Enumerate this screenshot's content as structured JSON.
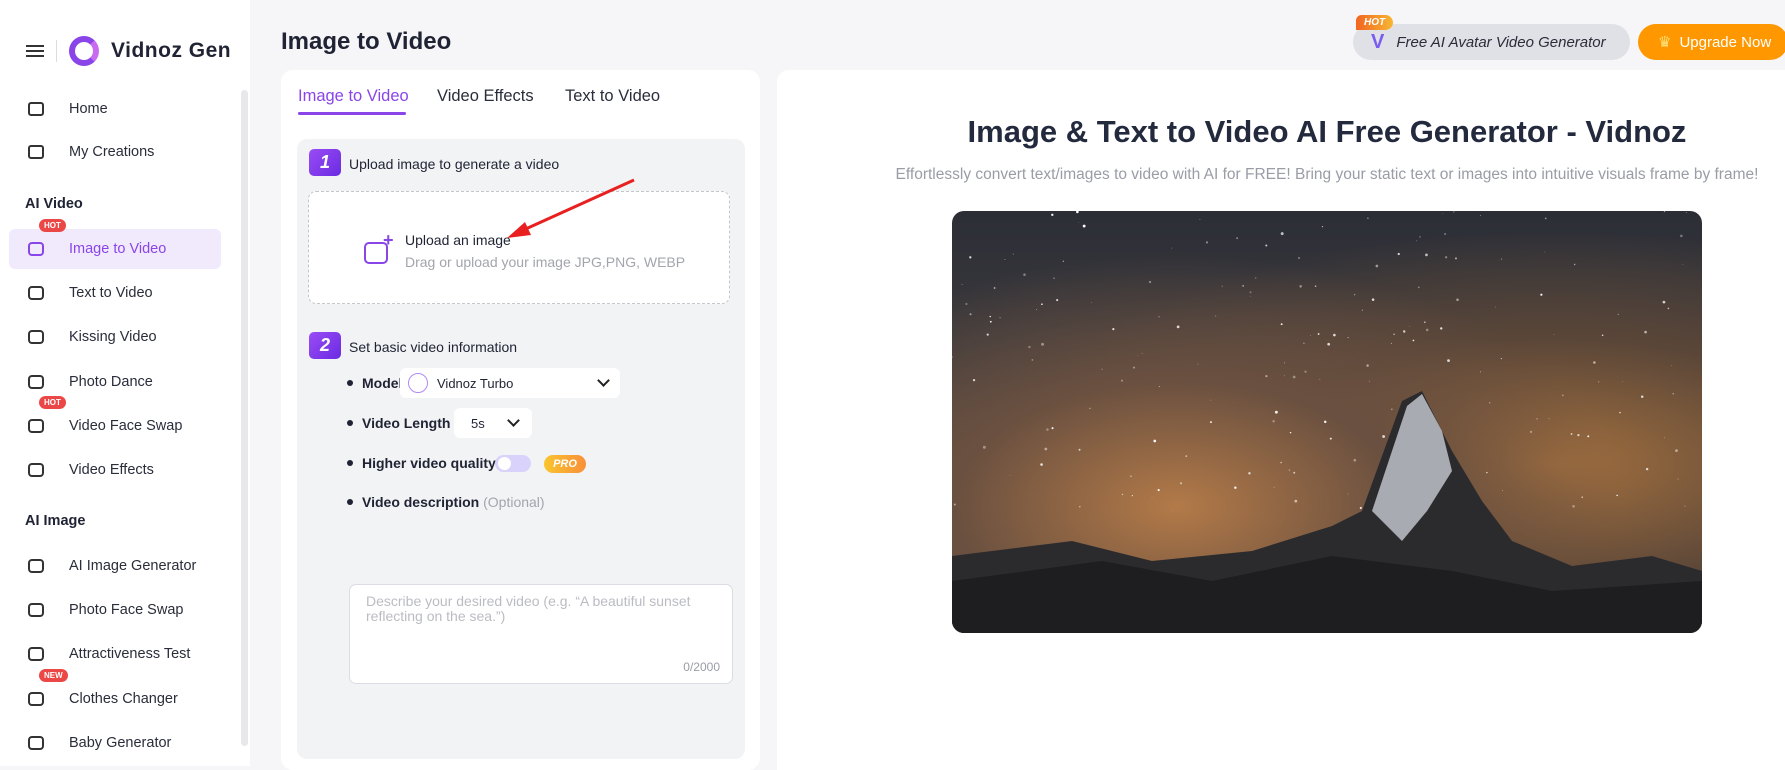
{
  "brand": {
    "name": "Vidnoz Gen",
    "accent": "#8a45e8"
  },
  "sidebar": {
    "top": [
      {
        "label": "Home",
        "icon": "home-icon"
      },
      {
        "label": "My Creations",
        "icon": "archive-icon"
      }
    ],
    "sections": [
      {
        "title": "AI Video",
        "items": [
          {
            "label": "Image to Video",
            "icon": "image-video-icon",
            "badge": "HOT",
            "active": true
          },
          {
            "label": "Text to Video",
            "icon": "text-video-icon"
          },
          {
            "label": "Kissing Video",
            "icon": "hearts-icon"
          },
          {
            "label": "Photo Dance",
            "icon": "dance-icon"
          },
          {
            "label": "Video Face Swap",
            "icon": "face-swap-icon",
            "badge": "HOT"
          },
          {
            "label": "Video Effects",
            "icon": "sparkle-play-icon"
          }
        ]
      },
      {
        "title": "AI Image",
        "items": [
          {
            "label": "AI Image Generator",
            "icon": "sparkles-icon"
          },
          {
            "label": "Photo Face Swap",
            "icon": "face-icon"
          },
          {
            "label": "Attractiveness Test",
            "icon": "face-scan-icon"
          },
          {
            "label": "Clothes Changer",
            "icon": "shirt-icon",
            "badge": "NEW"
          },
          {
            "label": "Baby Generator",
            "icon": "baby-icon"
          }
        ]
      }
    ]
  },
  "header": {
    "title": "Image to Video",
    "promo_tag": "HOT",
    "promo_label": "Free AI Avatar Video Generator",
    "upgrade_label": "Upgrade Now"
  },
  "tabs": [
    {
      "label": "Image to Video",
      "active": true
    },
    {
      "label": "Video Effects"
    },
    {
      "label": "Text to Video"
    }
  ],
  "step1": {
    "num": "1",
    "title": "Upload image to generate a video",
    "upload_title": "Upload an image",
    "upload_hint": "Drag or upload your image JPG,PNG, WEBP"
  },
  "step2": {
    "num": "2",
    "title": "Set basic video information",
    "model_label": "Model with",
    "model_value": "Vidnoz Turbo",
    "length_label": "Video Length",
    "length_value": "5s",
    "quality_label": "Higher video quality",
    "quality_on": false,
    "pro": "PRO",
    "desc_label": "Video description",
    "desc_optional": "(Optional)",
    "desc_placeholder": "Describe your desired video (e.g. “A beautiful sunset reflecting on the sea.”)",
    "desc_count": "0/2000"
  },
  "main": {
    "heading": "Image & Text to Video AI Free Generator - Vidnoz",
    "subheading": "Effortlessly convert text/images to video with AI for FREE! Bring your static text or images into intuitive visuals frame by frame!"
  }
}
